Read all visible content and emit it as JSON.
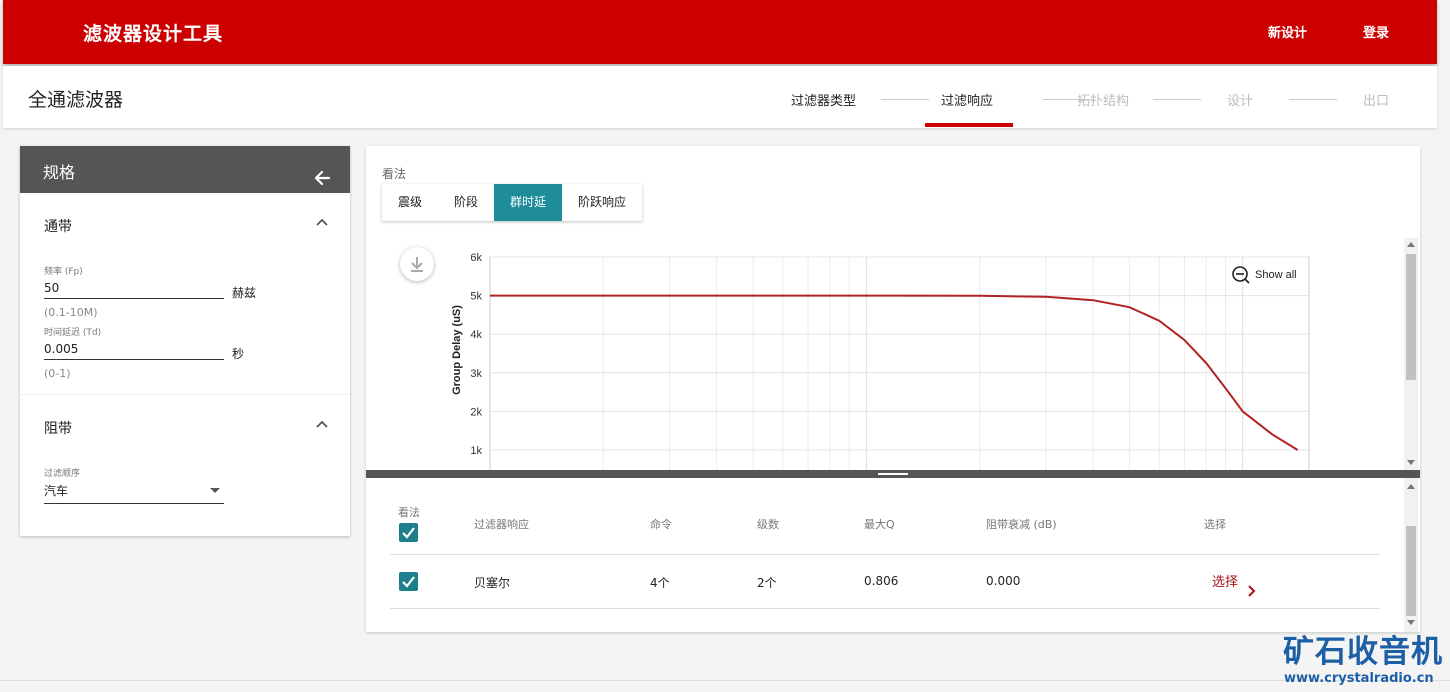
{
  "header": {
    "app_title": "滤波器设计工具",
    "new_design": "新设计",
    "login": "登录"
  },
  "page": {
    "title": "全通滤波器"
  },
  "steps": [
    {
      "label": "过滤器类型",
      "state": "done"
    },
    {
      "label": "过滤响应",
      "state": "active"
    },
    {
      "label": "拓扑结构",
      "state": "todo"
    },
    {
      "label": "设计",
      "state": "todo"
    },
    {
      "label": "出口",
      "state": "todo"
    }
  ],
  "spec": {
    "title": "规格",
    "passband": {
      "title": "通带",
      "freq_label": "频率 (Fp)",
      "freq_value": "50",
      "freq_unit": "赫兹",
      "freq_hint": "(0.1-10M)",
      "delay_label": "时间延迟 (Td)",
      "delay_value": "0.005",
      "delay_unit": "秒",
      "delay_hint": "(0-1)"
    },
    "stopband": {
      "title": "阻带",
      "order_label": "过滤顺序",
      "order_value": "汽车"
    }
  },
  "view": {
    "label": "看法",
    "tabs": [
      "震级",
      "阶段",
      "群时延",
      "阶跃响应"
    ],
    "active_tab": 2
  },
  "chart_data": {
    "type": "line",
    "ylabel": "Group Delay (uS)",
    "xlabel": "",
    "y_ticks": [
      "6k",
      "5k",
      "4k",
      "3k",
      "2k",
      "1k"
    ],
    "ylim": [
      1000,
      6000
    ],
    "xscale": "log",
    "show_all_label": "Show all",
    "series": [
      {
        "color": "#b22222",
        "points": [
          [
            1,
            5000
          ],
          [
            2,
            5000
          ],
          [
            5,
            5000
          ],
          [
            10,
            5000
          ],
          [
            20,
            4995
          ],
          [
            30,
            4970
          ],
          [
            40,
            4880
          ],
          [
            50,
            4700
          ],
          [
            60,
            4350
          ],
          [
            70,
            3850
          ],
          [
            80,
            3250
          ],
          [
            90,
            2600
          ],
          [
            100,
            2000
          ],
          [
            120,
            1400
          ],
          [
            140,
            1000
          ]
        ]
      }
    ]
  },
  "table": {
    "headers": {
      "view": "看法",
      "response": "过滤器响应",
      "order": "命令",
      "stages": "级数",
      "max_q": "最大Q",
      "stopband_atten": "阻带衰减 (dB)",
      "select": "选择"
    },
    "rows": [
      {
        "response": "贝塞尔",
        "order": "4个",
        "stages": "2个",
        "max_q": "0.806",
        "stopband_atten": "0.000",
        "select": "选择"
      }
    ]
  },
  "watermark": {
    "text": "矿石收音机",
    "url": "www.crystalradio.cn",
    "color": "#1d5fa6"
  }
}
